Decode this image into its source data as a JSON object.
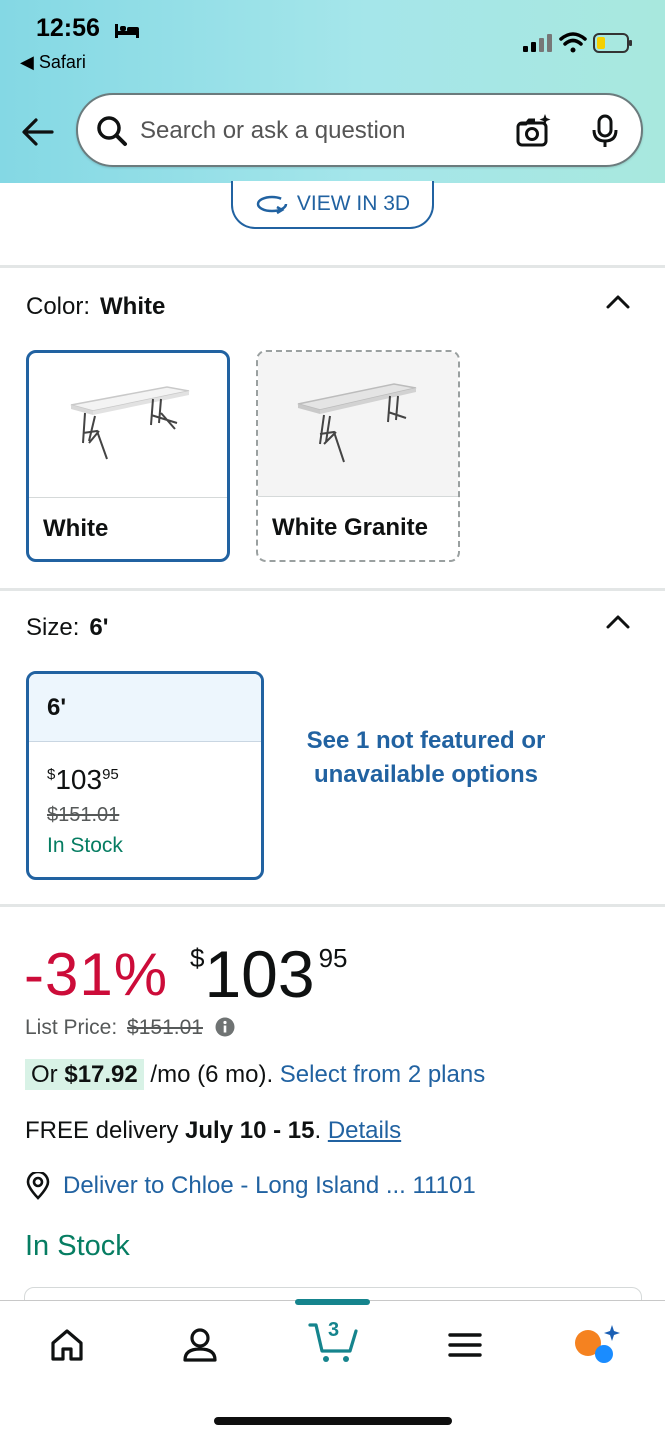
{
  "status_bar": {
    "time": "12:56",
    "back_app": "Safari"
  },
  "search": {
    "placeholder": "Search or ask a question"
  },
  "view_3d": {
    "label": "VIEW IN 3D"
  },
  "color_section": {
    "label": "Color:",
    "selected": "White",
    "swatches": [
      {
        "name": "White"
      },
      {
        "name": "White Granite"
      }
    ]
  },
  "size_section": {
    "label": "Size:",
    "selected": "6'",
    "card": {
      "size": "6'",
      "currency": "$",
      "price_whole": "103",
      "price_cents": "95",
      "list_price": "$151.01",
      "stock": "In Stock"
    },
    "see_more": "See 1 not featured or unavailable options"
  },
  "price_block": {
    "discount": "-31%",
    "currency": "$",
    "price_whole": "103",
    "price_cents": "95",
    "list_label": "List Price:",
    "list_price": "$151.01",
    "monthly_prefix": "Or",
    "monthly_amount": "$17.92",
    "monthly_suffix": "/mo (6 mo).",
    "monthly_link": "Select from 2 plans",
    "delivery_prefix": "FREE delivery",
    "delivery_dates": "July 10 - 15",
    "delivery_link": "Details",
    "deliver_to": "Deliver to Chloe - Long Island ... 11101",
    "stock": "In Stock"
  },
  "bottom_nav": {
    "cart_count": "3"
  },
  "colors": {
    "link": "#2162a1",
    "deal_red": "#cc0c39",
    "stock_green": "#067d62",
    "cart_teal": "#15848d"
  }
}
